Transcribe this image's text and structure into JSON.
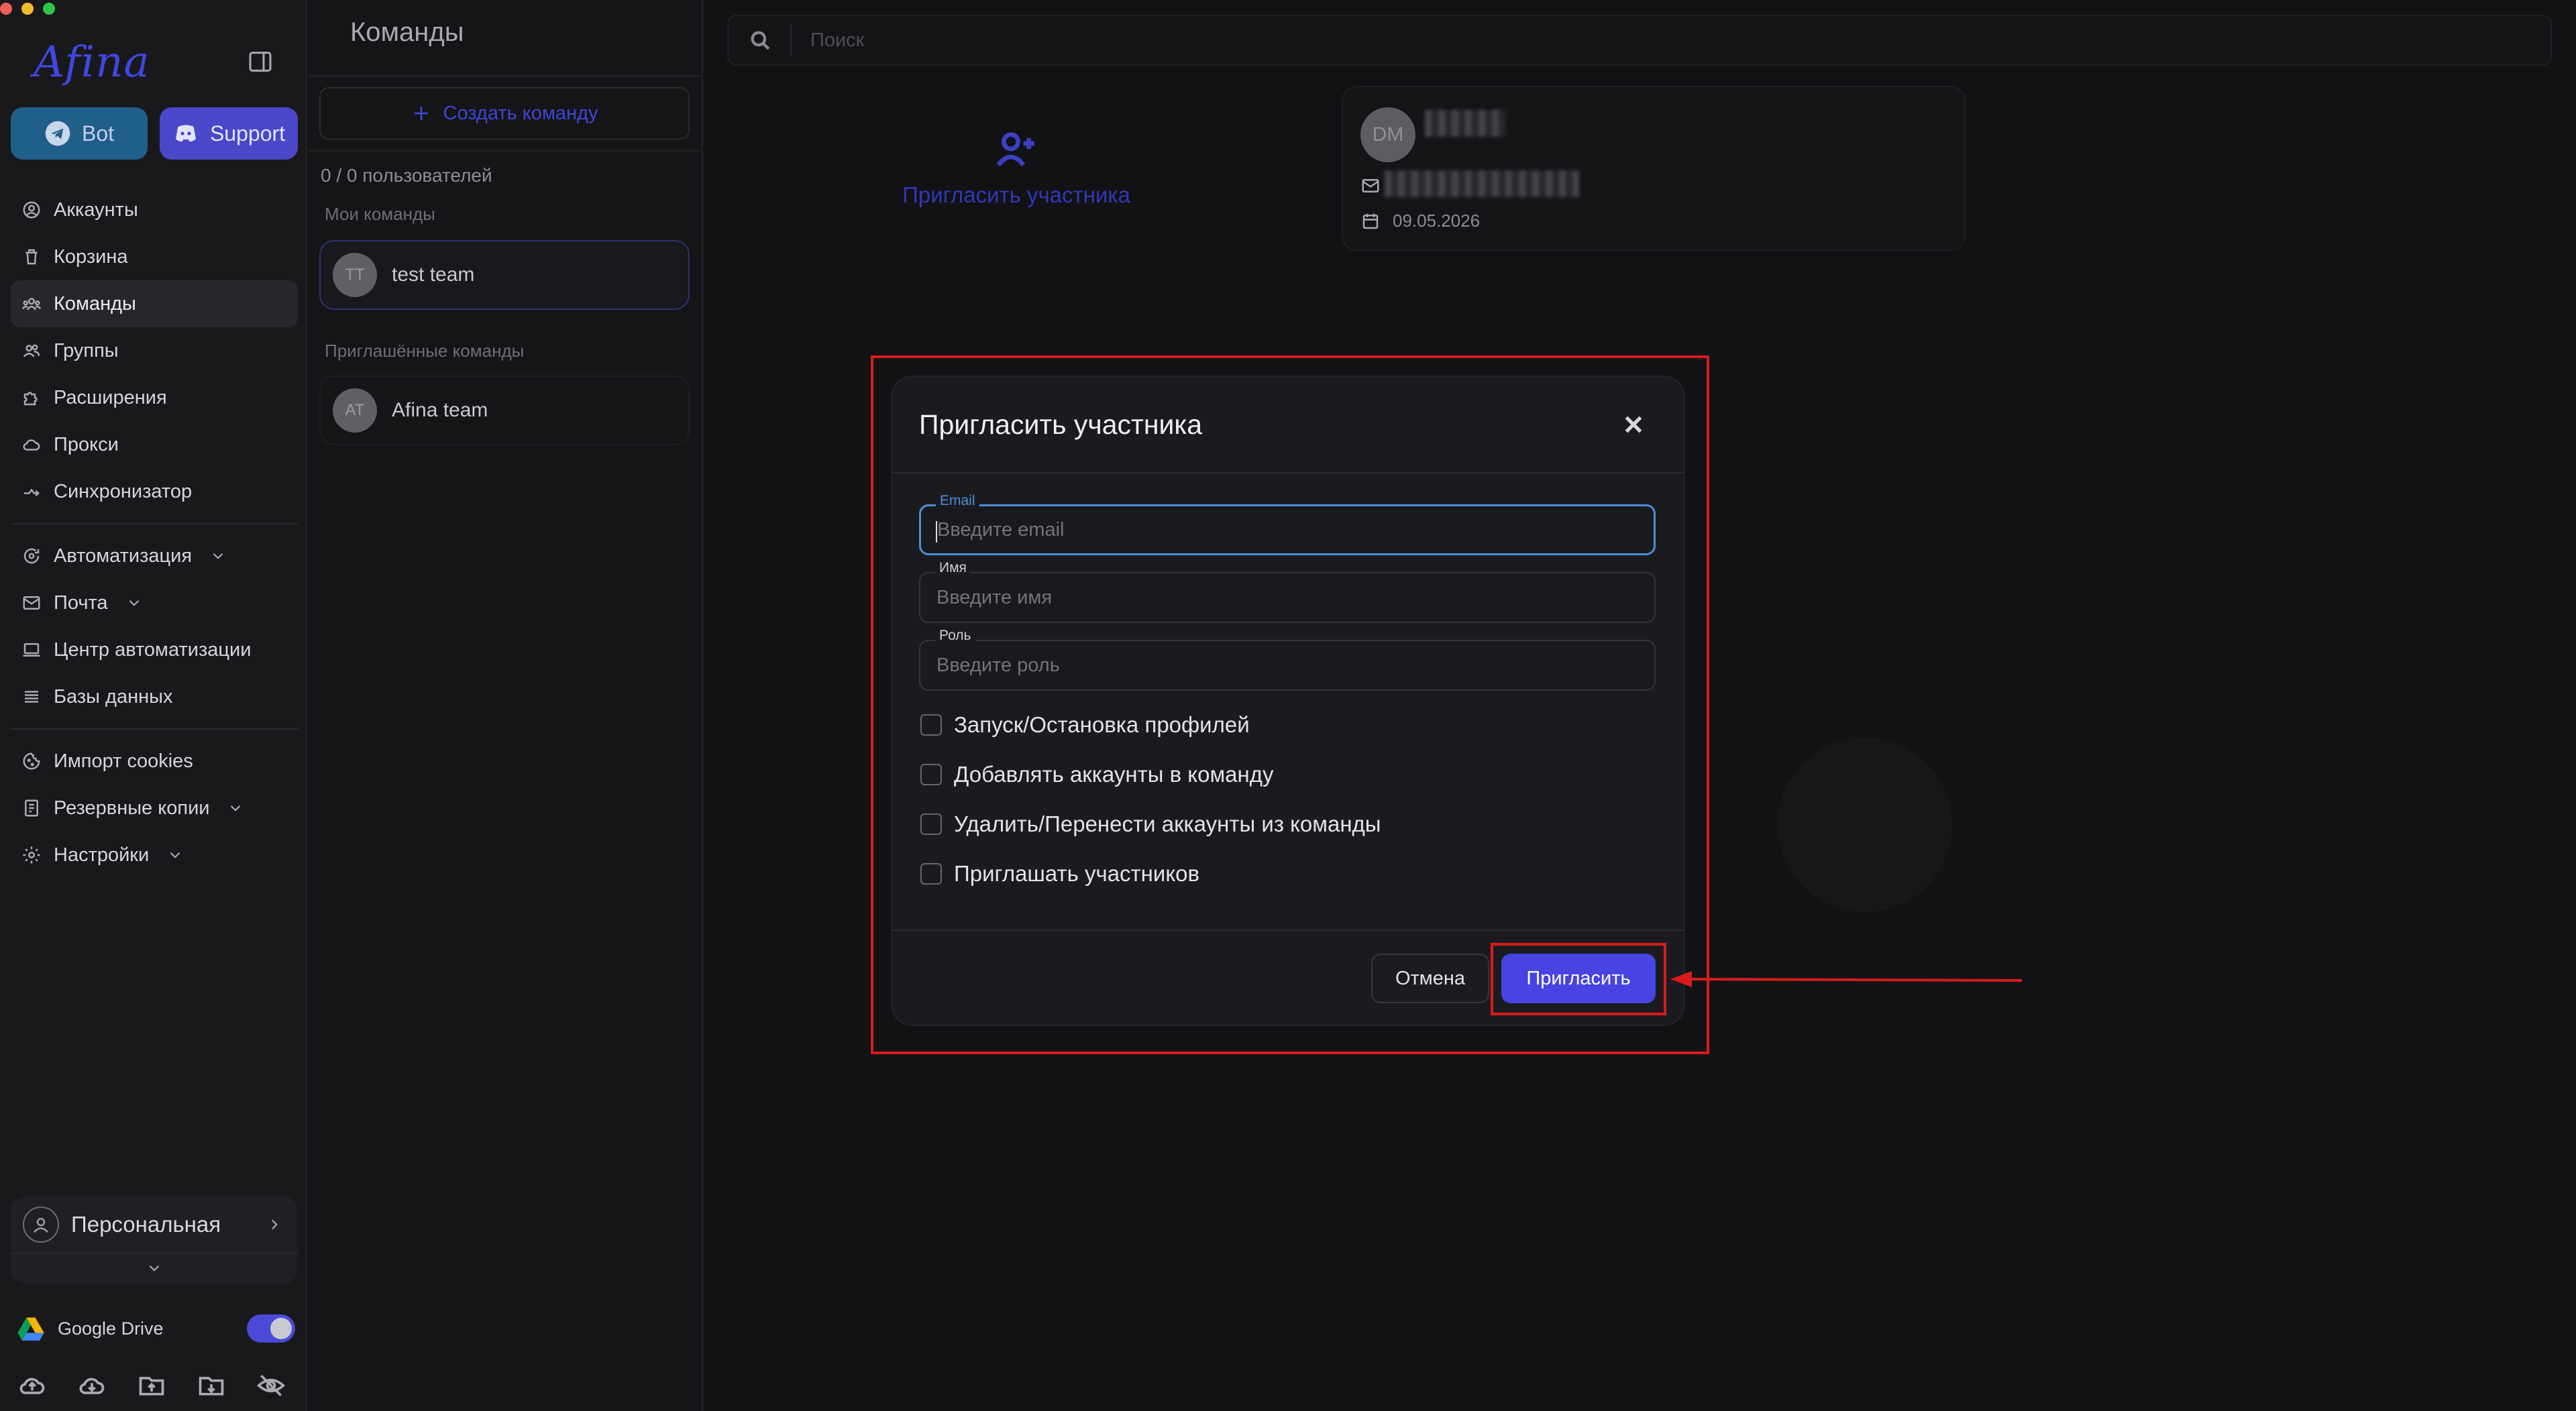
{
  "colors": {
    "accent": "#4744e2",
    "highlight": "#d81b1b",
    "focus": "#4a8fd6",
    "bot_button": "#1f5f8a",
    "support_button": "#4a47c9"
  },
  "sidebar": {
    "logo": "Afina",
    "bot_label": "Bot",
    "support_label": "Support",
    "nav_primary": [
      {
        "label": "Аккаунты",
        "icon": "user-circle-icon"
      },
      {
        "label": "Корзина",
        "icon": "trash-icon"
      },
      {
        "label": "Команды",
        "icon": "team-icon",
        "active": true
      },
      {
        "label": "Группы",
        "icon": "users-icon"
      },
      {
        "label": "Расширения",
        "icon": "puzzle-icon"
      },
      {
        "label": "Прокси",
        "icon": "cloud-icon"
      },
      {
        "label": "Синхронизатор",
        "icon": "sync-icon"
      }
    ],
    "nav_secondary": [
      {
        "label": "Автоматизация",
        "icon": "automation-icon",
        "has_dropdown": true
      },
      {
        "label": "Почта",
        "icon": "mail-icon",
        "has_dropdown": true
      },
      {
        "label": "Центр автоматизации",
        "icon": "laptop-icon"
      },
      {
        "label": "Базы данных",
        "icon": "list-icon"
      }
    ],
    "nav_tertiary": [
      {
        "label": "Импорт cookies",
        "icon": "cookie-icon"
      },
      {
        "label": "Резервные копии",
        "icon": "backup-icon",
        "has_dropdown": true
      },
      {
        "label": "Настройки",
        "icon": "gear-icon",
        "has_dropdown": true
      }
    ],
    "workspace_label": "Персональная",
    "google_drive_label": "Google Drive",
    "google_drive_enabled": true
  },
  "teams_panel": {
    "title": "Команды",
    "create_button": "Создать команду",
    "users_count": "0 / 0 пользователей",
    "my_teams_label": "Мои команды",
    "my_teams": [
      {
        "initials": "TT",
        "name": "test team"
      }
    ],
    "invited_teams_label": "Приглашённые команды",
    "invited_teams": [
      {
        "initials": "AT",
        "name": "Afina team"
      }
    ]
  },
  "main": {
    "search_placeholder": "Поиск",
    "invite_member_label": "Пригласить участника",
    "member": {
      "initials": "DM",
      "date": "09.05.2026"
    }
  },
  "modal": {
    "title": "Пригласить участника",
    "fields": {
      "email": {
        "label": "Email",
        "placeholder": "Введите email",
        "value": ""
      },
      "name": {
        "label": "Имя",
        "placeholder": "Введите имя",
        "value": ""
      },
      "role": {
        "label": "Роль",
        "placeholder": "Введите роль",
        "value": ""
      }
    },
    "permissions": [
      {
        "label": "Запуск/Остановка профилей",
        "checked": false
      },
      {
        "label": "Добавлять аккаунты в команду",
        "checked": false
      },
      {
        "label": "Удалить/Перенести аккаунты из команды",
        "checked": false
      },
      {
        "label": "Приглашать участников",
        "checked": false
      }
    ],
    "cancel_label": "Отмена",
    "invite_label": "Пригласить"
  }
}
